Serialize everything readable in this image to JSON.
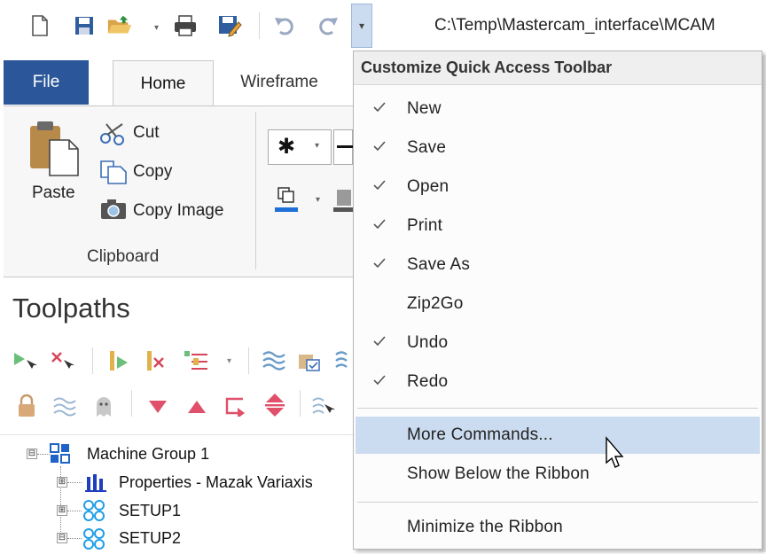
{
  "window": {
    "title_path": "C:\\Temp\\Mastercam_interface\\MCAM"
  },
  "quick_access": {
    "icons": [
      "new-file-icon",
      "save-icon",
      "open-folder-icon",
      "print-icon",
      "save-as-icon",
      "undo-icon",
      "redo-icon",
      "customize-dropdown-icon"
    ]
  },
  "tabs": [
    {
      "label": "File"
    },
    {
      "label": "Home"
    },
    {
      "label": "Wireframe"
    }
  ],
  "ribbon": {
    "clipboard": {
      "paste_label": "Paste",
      "cut_label": "Cut",
      "copy_label": "Copy",
      "copy_image_label": "Copy Image",
      "group_label": "Clipboard"
    }
  },
  "toolpaths": {
    "title": "Toolpaths",
    "tree": [
      {
        "label": "Machine Group 1",
        "expander": "⊟"
      },
      {
        "label": "Properties - Mazak Variaxis",
        "expander": "⊞"
      },
      {
        "label": "SETUP1",
        "expander": "⊞"
      },
      {
        "label": "SETUP2",
        "expander": "⊟"
      }
    ]
  },
  "menu": {
    "header": "Customize Quick Access Toolbar",
    "items": [
      {
        "label": "New",
        "checked": true
      },
      {
        "label": "Save",
        "checked": true
      },
      {
        "label": "Open",
        "checked": true
      },
      {
        "label": "Print",
        "checked": true
      },
      {
        "label": "Save As",
        "checked": true
      },
      {
        "label": "Zip2Go",
        "checked": false
      },
      {
        "label": "Undo",
        "checked": true
      },
      {
        "label": "Redo",
        "checked": true
      }
    ],
    "more_commands": "More Commands...",
    "show_below": "Show Below the Ribbon",
    "minimize": "Minimize the Ribbon"
  },
  "colors": {
    "file_tab": "#2b579a",
    "highlight": "#ccdcf0",
    "accent_blue": "#1f5fbf"
  }
}
